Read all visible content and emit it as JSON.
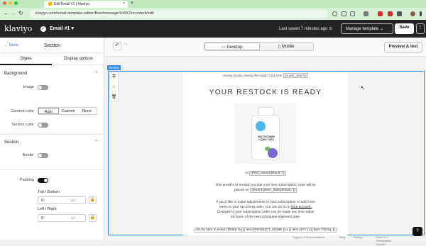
{
  "browser": {
    "tab_title": "Edit Email #1 | Klaviyo",
    "tab_close": "×",
    "new_tab": "+",
    "url": "klaviyo.com/email-template-editor/flow/message/Ut3X7k/content/edit"
  },
  "app": {
    "logo": "klaviyo",
    "email_name": "Email #1",
    "saved_status": "Last saved 7 minutes ago",
    "manage_template": "Manage template",
    "save": "Save"
  },
  "panel": {
    "done": "Done",
    "title": "Section",
    "tabs": [
      "Styles",
      "Display options"
    ],
    "background_header": "Background",
    "image_label": "Image",
    "content_color_label": "Content color",
    "content_color_options": [
      "Auto",
      "Custom",
      "None"
    ],
    "section_color_label": "Section color",
    "section_header": "Section",
    "border_label": "Border",
    "padding_label": "Padding",
    "top_bottom_label": "Top / Bottom",
    "top_bottom_value": "0",
    "left_right_label": "Left / Right",
    "left_right_value": "0",
    "unit": "px"
  },
  "toolbar": {
    "desktop": "Desktop",
    "mobile": "Mobile",
    "preview": "Preview & test"
  },
  "canvas": {
    "section_tag": "Section"
  },
  "email": {
    "trouble_text": "Having trouble viewing this email? Click here",
    "web_view_tag": "{% web_view %}",
    "headline": "YOUR RESTOCK IS READY",
    "product_label": "MULTIVITAMIN LIQUID CAPS",
    "greeting": "Hi",
    "name_tag": "{{first_name|default:''}}",
    "reminder_line1": "This email is to remind you that your next subscription order will be",
    "reminder_line2_prefix": "placed on",
    "date_tag": "{{event.place_date|default:''}}",
    "adjust_line1": "If you'd like to make adjustments to your subscription or add more",
    "adjust_line2_prefix": "items to your upcoming order, you can do so in",
    "account_link": "your account.",
    "adjust_line3": "Changes to your subscription order can be made any time within",
    "adjust_line4": "48 hours of the next scheduled shipment date.",
    "items_line": "{% for item in event.ITEMS %} {{ item.PRODUCT_NAME }} x {{ item.QTY }} {{ item.TOTAL }}"
  },
  "footer": {
    "support": "Support & Documentation",
    "blog": "Blog",
    "klaviyo": "Klaviyo",
    "help_link": "How Do I Personalize Emails?",
    "help_button": "?"
  },
  "colors": {
    "accent_blue": "#2e8be8",
    "header_dark": "#232426",
    "browser_green": "#bfe8bf"
  }
}
